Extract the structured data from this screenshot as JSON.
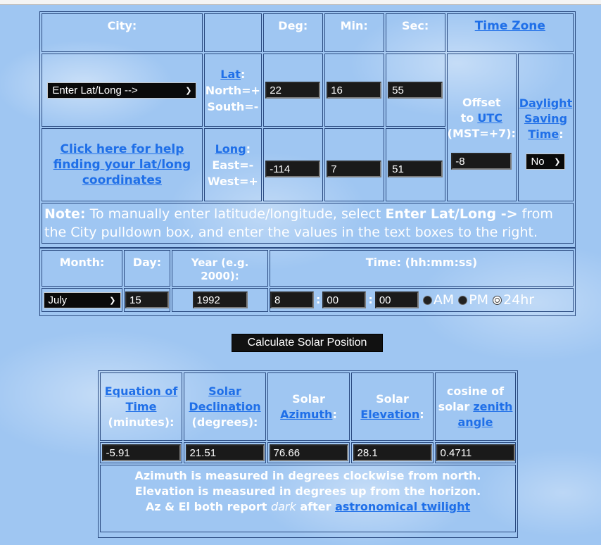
{
  "location": {
    "city_header": "City:",
    "deg_header": "Deg:",
    "min_header": "Min:",
    "sec_header": "Sec:",
    "timezone_link": "Time Zone",
    "city_selected": "Enter Lat/Long -->",
    "lat_link": "Lat",
    "lat_colon": ":",
    "north_label": "North=+",
    "south_label": "South=-",
    "lat_deg": "22",
    "lat_min": "16",
    "lat_sec": "55",
    "help_link": "Click here for help finding your lat/long coordinates",
    "long_link": "Long",
    "long_colon": ":",
    "east_label": "East=-",
    "west_label": "West=+",
    "long_deg": "-114",
    "long_min": "7",
    "long_sec": "51",
    "offset_line1": "Offset",
    "offset_to": "to",
    "utc_link": "UTC",
    "offset_line3": "(MST=+7):",
    "offset_value": "-8",
    "daylight_link": "Daylight Saving Time",
    "daylight_colon": ":",
    "daylight_selected": "No",
    "note_label": "Note:",
    "note_text1": " To manually enter latitude/longitude, select ",
    "note_bold": "Enter Lat/Long ->",
    "note_text2": " from the City pulldown box, and enter the values in the text boxes to the right."
  },
  "datetime": {
    "month_header": "Month:",
    "day_header": "Day:",
    "year_header": "Year (e.g. 2000):",
    "time_header": "Time: (hh:mm:ss)",
    "month_selected": "July",
    "day": "15",
    "year": "1992",
    "hour": "8",
    "minute": "00",
    "second": "00",
    "sep": ":",
    "am_label": "AM",
    "pm_label": "PM",
    "h24_label": "24hr"
  },
  "calculate_label": "Calculate Solar Position",
  "results": {
    "eot_link": "Equation of Time",
    "eot_unit": "(minutes):",
    "decl_link": "Solar Declination",
    "decl_unit": "(degrees):",
    "az_word": "Solar",
    "az_link": "Azimuth",
    "az_colon": ":",
    "el_word": "Solar",
    "el_link": "Elevation",
    "el_colon": ":",
    "cos_text": "cosine of solar",
    "zenith_link": "zenith angle",
    "eot_value": "-5.91",
    "decl_value": "21.51",
    "az_value": "76.66",
    "el_value": "28.1",
    "cos_value": "0.4711",
    "note_line1": "Azimuth is measured in degrees clockwise from north.",
    "note_line2": "Elevation is measured in degrees up from the horizon.",
    "note_line3a": "Az & El both report ",
    "note_dark": "dark",
    "note_line3b": " after ",
    "twilight_link": "astronomical twilight"
  },
  "colors": {
    "link": "#1f6fe8",
    "label": "#ffffff",
    "field_bg": "#1a1a1a",
    "background": "#9fc6f2"
  }
}
